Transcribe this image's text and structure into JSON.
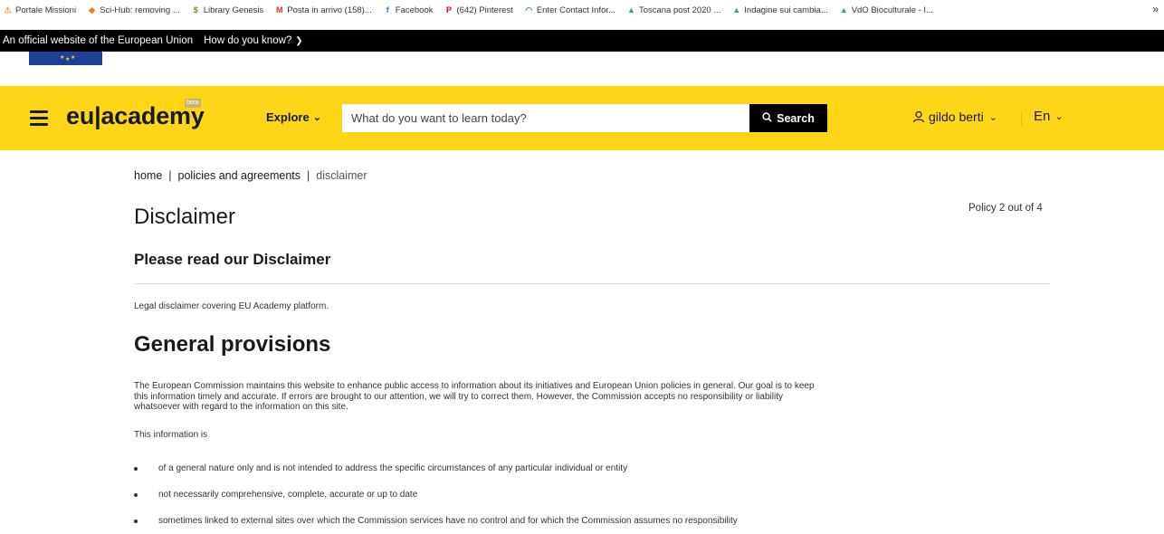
{
  "bookmarks": [
    {
      "label": "Portale Missioni",
      "icon": "warning-icon",
      "color": "#e8a33c"
    },
    {
      "label": "Sci-Hub: removing ...",
      "icon": "raven-icon",
      "color": "#e67e22"
    },
    {
      "label": "Library Genesis",
      "icon": "dollar-icon",
      "color": "#6b8e23"
    },
    {
      "label": "Posta in arrivo (158)...",
      "icon": "gmail-icon",
      "color": "#d93025"
    },
    {
      "label": "Facebook",
      "icon": "facebook-icon",
      "color": "#1877f2"
    },
    {
      "label": "(642) Pinterest",
      "icon": "pinterest-icon",
      "color": "#e60023"
    },
    {
      "label": "Enter Contact Infor...",
      "icon": "wifi-icon",
      "color": "#3a7bd5"
    },
    {
      "label": "Toscana post 2020 ...",
      "icon": "drive-icon",
      "color": "#34a853"
    },
    {
      "label": "Indagine sui cambia...",
      "icon": "drive-icon",
      "color": "#34a853"
    },
    {
      "label": "VdO Bioculturale - I...",
      "icon": "drive-icon",
      "color": "#34a853"
    }
  ],
  "bookmarks_more": "»",
  "eu_banner": {
    "official": "An official website of the European Union",
    "how": "How do you know?"
  },
  "header": {
    "logo": "eu|academy",
    "beta": "beta",
    "explore": "Explore",
    "search_placeholder": "What do you want to learn today?",
    "search_button": "Search",
    "user": "gildo berti",
    "language": "En",
    "accent": "#ffd617"
  },
  "breadcrumb": [
    "home",
    "policies and agreements",
    "disclaimer"
  ],
  "page": {
    "title": "Disclaimer",
    "policy_count": "Policy 2 out of 4",
    "subtitle": "Please read our Disclaimer",
    "summary": "Legal disclaimer covering EU Academy platform.",
    "section_title": "General provisions",
    "paragraph_lines": [
      "The European Commission maintains this website to enhance public access to information about its initiatives and European Union policies in general. Our goal is to keep",
      "this information timely and accurate. If errors are brought to our attention, we will try to correct them. However, the Commission accepts no responsibility or liability",
      "whatsoever with regard to the information on this site."
    ],
    "intro": "This information is",
    "bullets": [
      "of a general nature only and is not intended to address the specific circumstances of any particular individual or entity",
      "not necessarily comprehensive, complete, accurate or up to date",
      "sometimes linked to external sites over which the Commission services have no control and for which the Commission assumes no responsibility"
    ]
  }
}
